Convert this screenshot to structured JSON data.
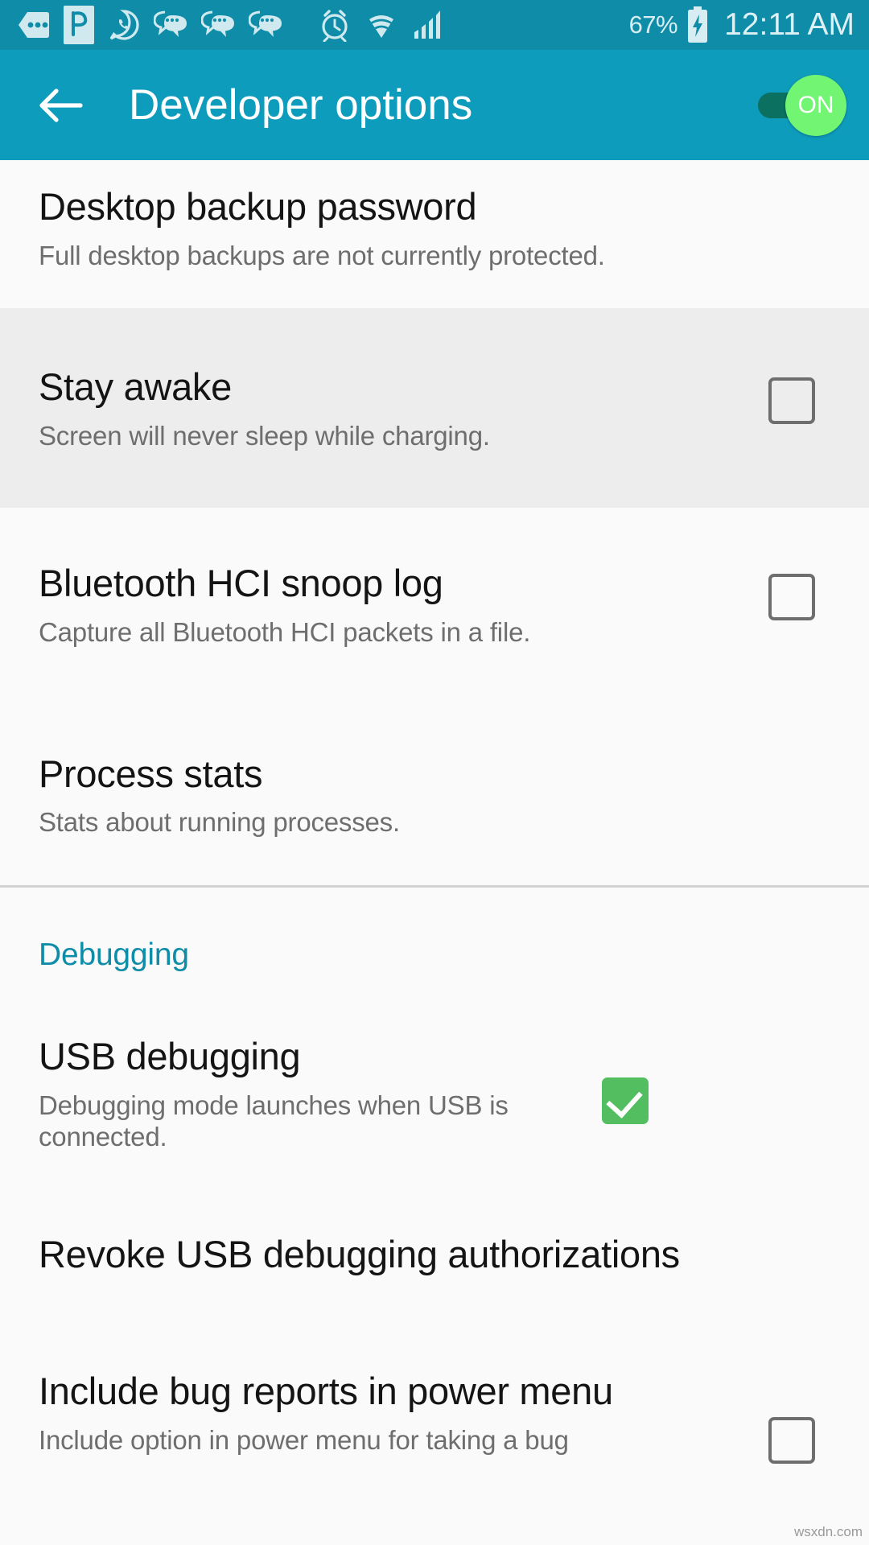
{
  "status_bar": {
    "icons": [
      {
        "name": "messages-dots-icon",
        "glyph": "dots-pentagon"
      },
      {
        "name": "pushbullet-icon",
        "glyph": "p-badge"
      },
      {
        "name": "whatsapp-icon",
        "glyph": "whatsapp"
      },
      {
        "name": "chat-bubble-icon-1",
        "glyph": "double-bubble"
      },
      {
        "name": "chat-bubble-icon-2",
        "glyph": "double-bubble"
      },
      {
        "name": "chat-bubble-icon-3",
        "glyph": "double-bubble"
      },
      {
        "name": "alarm-clock-icon",
        "glyph": "alarm"
      },
      {
        "name": "wifi-icon",
        "glyph": "wifi"
      },
      {
        "name": "cellular-signal-icon",
        "glyph": "signal"
      }
    ],
    "battery_percent": "67%",
    "battery_charging": true,
    "clock": "12:11 AM"
  },
  "app_bar": {
    "back_label": "back",
    "title": "Developer options",
    "toggle_label": "ON",
    "toggle_on": true
  },
  "settings": [
    {
      "id": "desktop-backup-password",
      "title": "Desktop backup password",
      "subtitle": "Full desktop backups are not currently protected.",
      "control": "none",
      "highlight": false
    },
    {
      "id": "stay-awake",
      "title": "Stay awake",
      "subtitle": "Screen will never sleep while charging.",
      "control": "checkbox",
      "checked": false,
      "highlight": true
    },
    {
      "id": "bluetooth-hci-snoop-log",
      "title": "Bluetooth HCI snoop log",
      "subtitle": "Capture all Bluetooth HCI packets in a file.",
      "control": "checkbox",
      "checked": false,
      "highlight": false
    },
    {
      "id": "process-stats",
      "title": "Process stats",
      "subtitle": "Stats about running processes.",
      "control": "none",
      "highlight": false
    }
  ],
  "section_debugging": {
    "header": "Debugging",
    "items": [
      {
        "id": "usb-debugging",
        "title": "USB debugging",
        "subtitle": "Debugging mode launches when USB is connected.",
        "control": "checkbox",
        "checked": true
      },
      {
        "id": "revoke-usb-debugging-authorizations",
        "title": "Revoke USB debugging authorizations",
        "subtitle": "",
        "control": "none",
        "checked": false
      },
      {
        "id": "include-bug-reports-in-power-menu",
        "title": "Include bug reports in power menu",
        "subtitle": "Include option in power menu for taking a bug",
        "control": "checkbox",
        "checked": false
      }
    ]
  },
  "watermark": "wsxdn.com",
  "colors": {
    "status_bar_bg": "#0e8ca8",
    "app_bar_bg": "#0e9cbd",
    "accent_teal": "#0e8ca8",
    "toggle_thumb": "#72f573",
    "toggle_track": "#0c7061",
    "checkbox_checked": "#52be60",
    "page_bg": "#fafafa",
    "row_highlight_bg": "#ededed"
  }
}
